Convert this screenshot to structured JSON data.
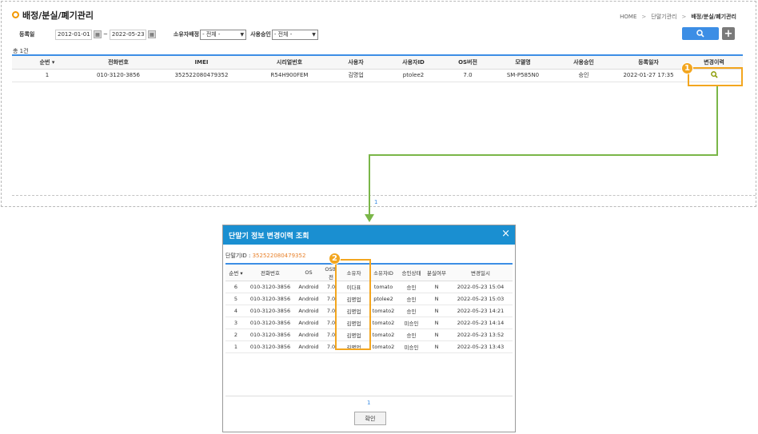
{
  "page": {
    "title": "배정/분실/폐기관리",
    "breadcrumb": [
      "HOME",
      "단말기관리",
      "배정/분실/폐기관리"
    ]
  },
  "filter": {
    "reg_date_label": "등록일",
    "date_from": "2012-01-01",
    "date_sep": "~",
    "date_to": "2022-05-23",
    "owner_assign_label": "소유자배정",
    "owner_assign_value": "- 전체 -",
    "use_approval_label": "사용승인",
    "use_approval_value": "- 전체 -"
  },
  "main": {
    "count": "총 1건",
    "columns": [
      "순번",
      "전화번호",
      "IMEI",
      "시리얼번호",
      "사용자",
      "사용자ID",
      "OS버전",
      "모델명",
      "사용승인",
      "등록일자",
      "변경이력"
    ],
    "sort_marker": "▾",
    "rows": [
      [
        "1",
        "010-3120-3856",
        "352522080479352",
        "R54H900FEM",
        "김명업",
        "ptolee2",
        "7.0",
        "SM-P585N0",
        "승인",
        "2022-01-27 17:35"
      ]
    ],
    "pager": "1"
  },
  "badges": {
    "one": "1",
    "two": "2"
  },
  "modal": {
    "title": "단말기 정보 변경이력 조회",
    "close": "×",
    "device_id_label": "단말기ID :",
    "device_id_value": "352522080479352",
    "columns": [
      "순번",
      "전화번호",
      "OS",
      "OS버전",
      "소유자",
      "소유자ID",
      "승인상태",
      "분실여부",
      "변경일시"
    ],
    "rows": [
      [
        "6",
        "010-3120-3856",
        "Android",
        "7.0",
        "이다표",
        "tomato",
        "승인",
        "N",
        "2022-05-23 15:04"
      ],
      [
        "5",
        "010-3120-3856",
        "Android",
        "7.0",
        "김명업",
        "ptolee2",
        "승인",
        "N",
        "2022-05-23 15:03"
      ],
      [
        "4",
        "010-3120-3856",
        "Android",
        "7.0",
        "김명업",
        "tomato2",
        "승인",
        "N",
        "2022-05-23 14:21"
      ],
      [
        "3",
        "010-3120-3856",
        "Android",
        "7.0",
        "김명업",
        "tomato2",
        "미승인",
        "N",
        "2022-05-23 14:14"
      ],
      [
        "2",
        "010-3120-3856",
        "Android",
        "7.0",
        "김명업",
        "tomato2",
        "승인",
        "N",
        "2022-05-23 13:52"
      ],
      [
        "1",
        "010-3120-3856",
        "Android",
        "7.0",
        "김명업",
        "tomato2",
        "미승인",
        "N",
        "2022-05-23 13:43"
      ]
    ],
    "pager": "1",
    "ok_label": "확인"
  },
  "colors": {
    "accent": "#3c8ee5",
    "modal_header": "#1a8fd1",
    "highlight": "#f3a61f",
    "connector": "#7ab648"
  },
  "icons": {
    "search": "search-icon",
    "plus": "plus-icon",
    "calendar": "calendar-icon",
    "close": "close-icon"
  }
}
